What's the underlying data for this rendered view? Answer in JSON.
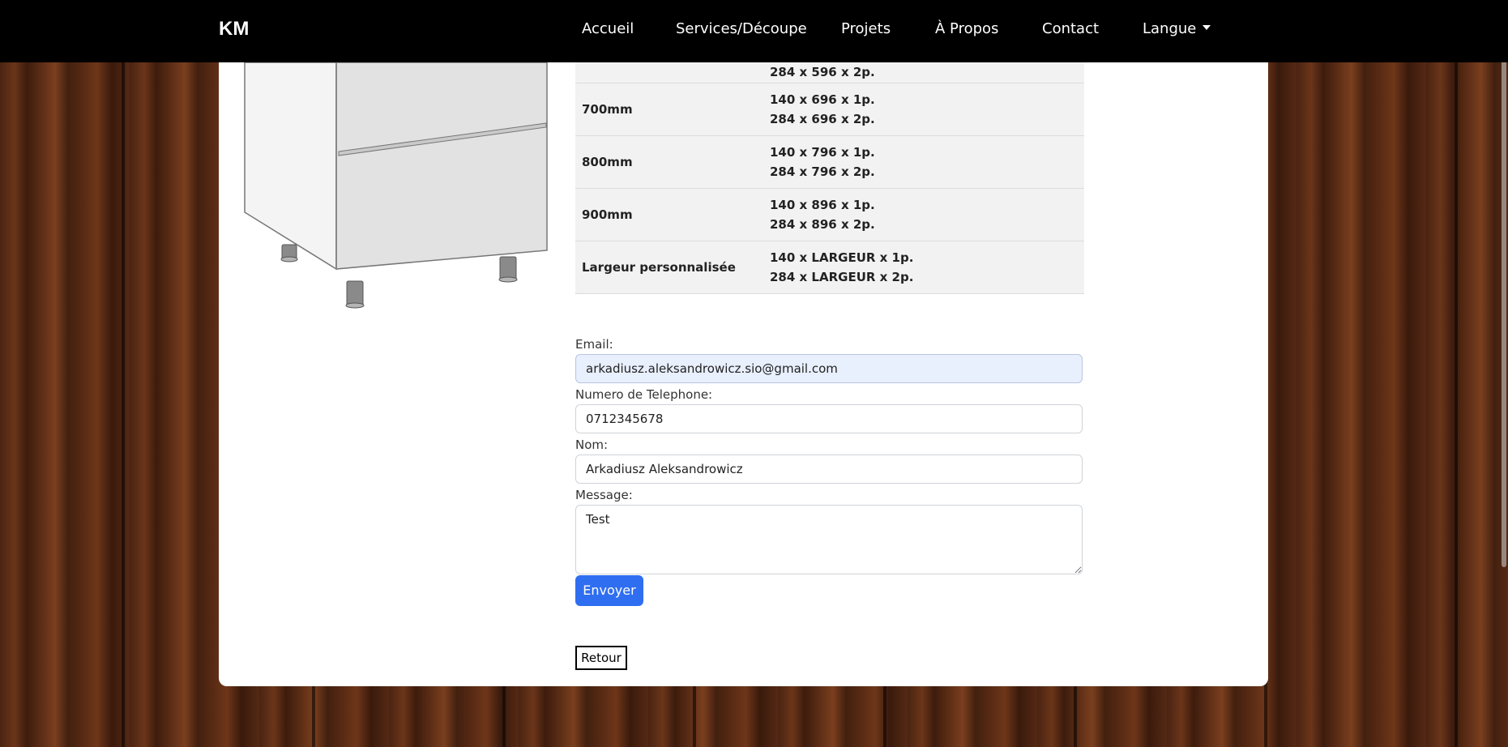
{
  "brand": "KM",
  "nav": {
    "items": [
      "Accueil",
      "Services/Découpe",
      "Projets",
      "À Propos",
      "Contact"
    ],
    "language": "Langue"
  },
  "spec_table": {
    "rows": [
      {
        "size": "",
        "dims": [
          "284 x 596 x 2p."
        ]
      },
      {
        "size": "700mm",
        "dims": [
          "140 x 696 x 1p.",
          "284 x 696 x 2p."
        ]
      },
      {
        "size": "800mm",
        "dims": [
          "140 x 796 x 1p.",
          "284 x 796 x 2p."
        ]
      },
      {
        "size": "900mm",
        "dims": [
          "140 x 896 x 1p.",
          "284 x 896 x 2p."
        ]
      },
      {
        "size": "Largeur personnalisée",
        "dims": [
          "140 x LARGEUR x 1p.",
          "284 x LARGEUR x 2p."
        ]
      }
    ]
  },
  "form": {
    "email_label": "Email:",
    "email_value": "arkadiusz.aleksandrowicz.sio@gmail.com",
    "phone_label": "Numero de Telephone:",
    "phone_value": "0712345678",
    "name_label": "Nom:",
    "name_value": "Arkadiusz Aleksandrowicz",
    "message_label": "Message:",
    "message_value": "Test",
    "submit": "Envoyer"
  },
  "back_button": "Retour",
  "icons": {
    "language_caret": "chevron-down-icon",
    "product": "cabinet-image"
  }
}
